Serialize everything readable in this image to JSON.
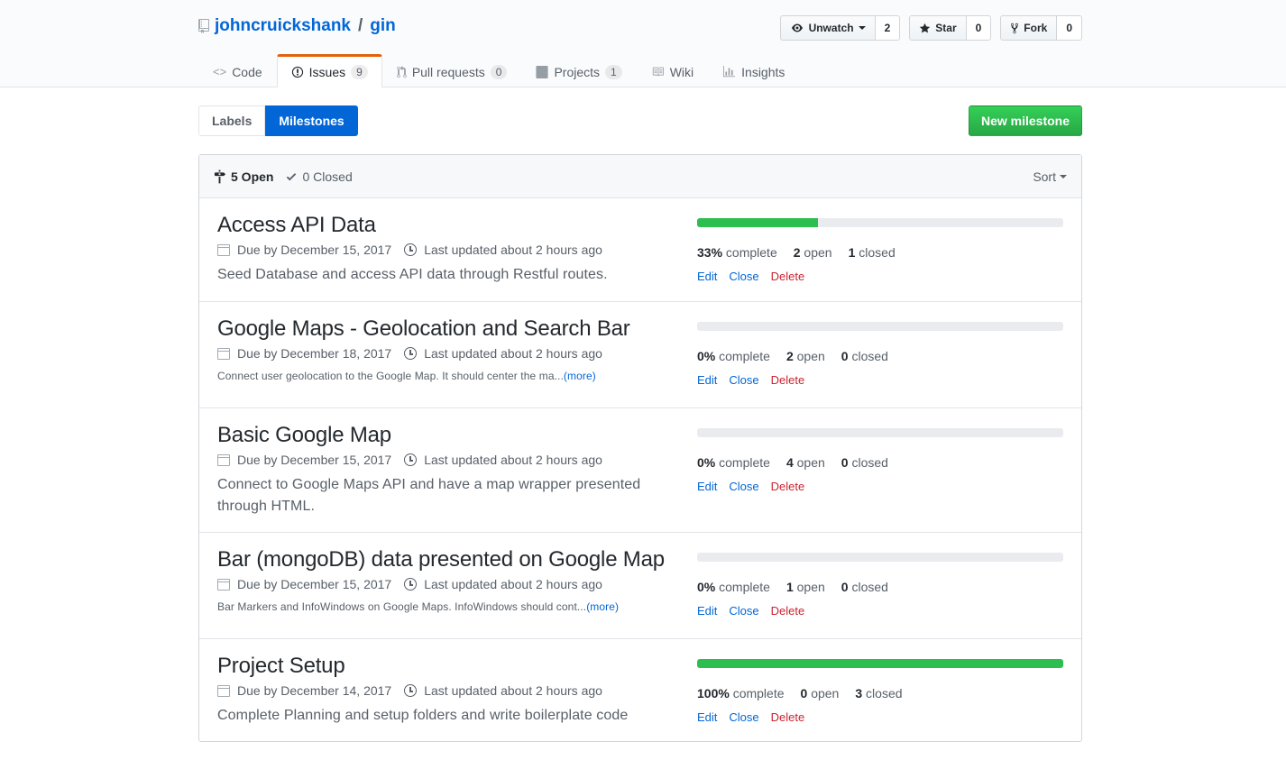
{
  "repo": {
    "owner": "johncruickshank",
    "separator": "/",
    "name": "gin"
  },
  "actions": {
    "watch": {
      "label": "Unwatch",
      "count": "2"
    },
    "star": {
      "label": "Star",
      "count": "0"
    },
    "fork": {
      "label": "Fork",
      "count": "0"
    }
  },
  "tabs": [
    {
      "label": "Code",
      "icon": "code-icon",
      "counter": ""
    },
    {
      "label": "Issues",
      "icon": "issue-opened-icon",
      "counter": "9"
    },
    {
      "label": "Pull requests",
      "icon": "pull-request-icon",
      "counter": "0"
    },
    {
      "label": "Projects",
      "icon": "project-icon",
      "counter": "1"
    },
    {
      "label": "Wiki",
      "icon": "book-icon",
      "counter": ""
    },
    {
      "label": "Insights",
      "icon": "graph-icon",
      "counter": ""
    }
  ],
  "subnav": {
    "labels": "Labels",
    "milestones": "Milestones",
    "new_milestone": "New milestone"
  },
  "filter": {
    "open": "5 Open",
    "closed": "0 Closed",
    "sort": "Sort"
  },
  "milestones": [
    {
      "title": "Access API Data",
      "due": "Due by December 15, 2017",
      "updated": "Last updated about 2 hours ago",
      "description": "Seed Database and access API data through Restful routes.",
      "more": "",
      "progress": 33,
      "complete": "33%",
      "complete_suffix": " complete",
      "open": "2",
      "open_suffix": " open",
      "closed": "1",
      "closed_suffix": " closed"
    },
    {
      "title": "Google Maps - Geolocation and Search Bar",
      "due": "Due by December 18, 2017",
      "updated": "Last updated about 2 hours ago",
      "description": "Connect user geolocation to the Google Map. It should center the ma...",
      "more": "(more)",
      "progress": 0,
      "complete": "0%",
      "complete_suffix": " complete",
      "open": "2",
      "open_suffix": " open",
      "closed": "0",
      "closed_suffix": " closed"
    },
    {
      "title": "Basic Google Map",
      "due": "Due by December 15, 2017",
      "updated": "Last updated about 2 hours ago",
      "description": "Connect to Google Maps API and have a map wrapper presented through HTML.",
      "more": "",
      "progress": 0,
      "complete": "0%",
      "complete_suffix": " complete",
      "open": "4",
      "open_suffix": " open",
      "closed": "0",
      "closed_suffix": " closed"
    },
    {
      "title": "Bar (mongoDB) data presented on Google Map",
      "due": "Due by December 15, 2017",
      "updated": "Last updated about 2 hours ago",
      "description": "Bar Markers and InfoWindows on Google Maps. InfoWindows should cont...",
      "more": "(more)",
      "progress": 0,
      "complete": "0%",
      "complete_suffix": " complete",
      "open": "1",
      "open_suffix": " open",
      "closed": "0",
      "closed_suffix": " closed"
    },
    {
      "title": "Project Setup",
      "due": "Due by December 14, 2017",
      "updated": "Last updated about 2 hours ago",
      "description": "Complete Planning and setup folders and write boilerplate code",
      "more": "",
      "progress": 100,
      "complete": "100%",
      "complete_suffix": " complete",
      "open": "0",
      "open_suffix": " open",
      "closed": "3",
      "closed_suffix": " closed"
    }
  ],
  "milestone_actions": {
    "edit": "Edit",
    "close": "Close",
    "delete": "Delete"
  },
  "colors": {
    "link": "#0366d6",
    "progress": "#2cbe4e",
    "primary": "#28a745",
    "delete": "#cb2431",
    "tab_accent": "#e36209"
  }
}
